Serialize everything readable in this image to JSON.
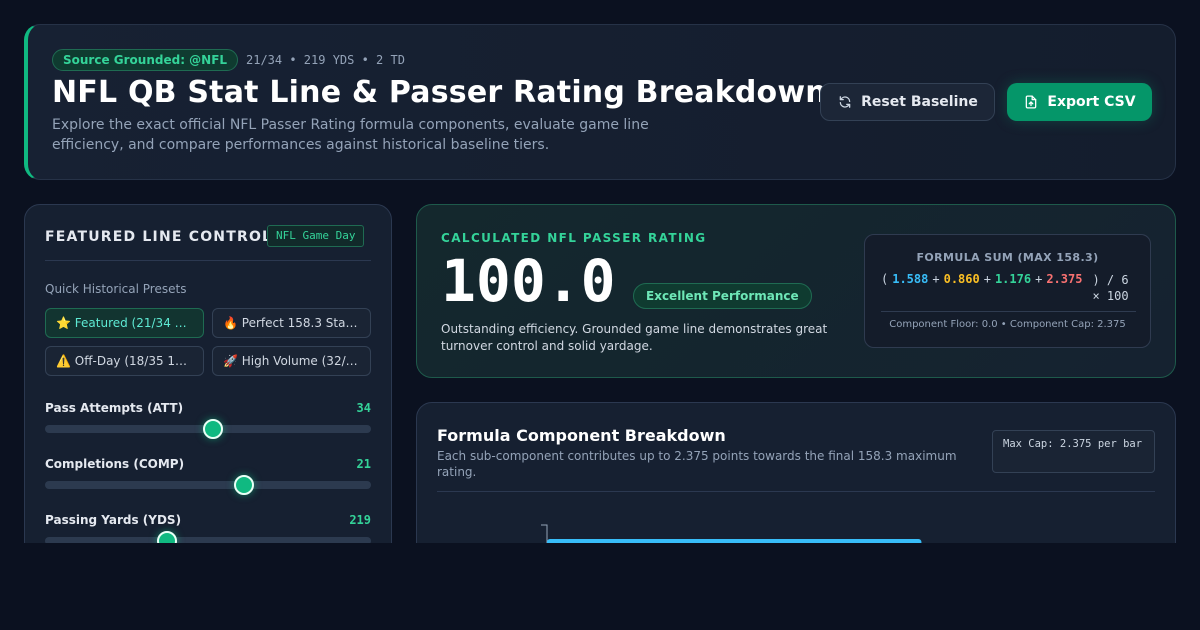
{
  "header": {
    "source_badge": "Source Grounded: @NFL",
    "stat_summary": "21/34 • 219 YDS • 2 TD",
    "title": "NFL QB Stat Line & Passer Rating Breakdown",
    "subtitle": "Explore the exact official NFL Passer Rating formula components, evaluate game line efficiency, and compare performances against historical baseline tiers.",
    "reset_label": "Reset Baseline",
    "export_label": "Export CSV"
  },
  "controls": {
    "title": "FEATURED LINE CONTROL",
    "tag": "NFL Game Day",
    "presets_label": "Quick Historical Presets",
    "presets": [
      {
        "icon": "⭐",
        "label": "Featured (21/34 …",
        "active": true
      },
      {
        "icon": "🔥",
        "label": "Perfect 158.3 Sta…",
        "active": false
      },
      {
        "icon": "⚠️",
        "label": "Off-Day (18/35 1…",
        "active": false
      },
      {
        "icon": "🚀",
        "label": "High Volume (32/…",
        "active": false
      }
    ],
    "sliders": [
      {
        "label": "Pass Attempts (ATT)",
        "value": "34",
        "fraction": 0.515
      },
      {
        "label": "Completions (COMP)",
        "value": "21",
        "fraction": 0.61
      },
      {
        "label": "Passing Yards (YDS)",
        "value": "219",
        "fraction": 0.375
      }
    ]
  },
  "rating": {
    "label": "CALCULATED NFL PASSER RATING",
    "value": "100.0",
    "tier": "Excellent Performance",
    "description": "Outstanding efficiency. Grounded game line demonstrates great turnover control and solid yardage.",
    "formula_title": "FORMULA SUM (MAX 158.3)",
    "open_paren": "(",
    "components": [
      "1.588",
      "0.860",
      "1.176",
      "2.375"
    ],
    "plus": "+",
    "tail_line1": ") / 6",
    "tail_line2": "× 100",
    "formula_foot": "Component Floor: 0.0 • Component Cap: 2.375",
    "colors": {
      "c1": "#38bdf8",
      "c2": "#fbbf24",
      "c3": "#34d399",
      "c4": "#f87171"
    }
  },
  "breakdown": {
    "title": "Formula Component Breakdown",
    "subtitle": "Each sub-component contributes up to 2.375 points towards the final 158.3 maximum rating.",
    "cap_badge": "Max Cap: 2.375 per bar"
  },
  "chart_data": {
    "type": "bar",
    "orientation": "horizontal",
    "categories": [],
    "values": [
      1.588
    ],
    "xlim": [
      0,
      2.375
    ],
    "colors": [
      "#38bdf8"
    ]
  }
}
